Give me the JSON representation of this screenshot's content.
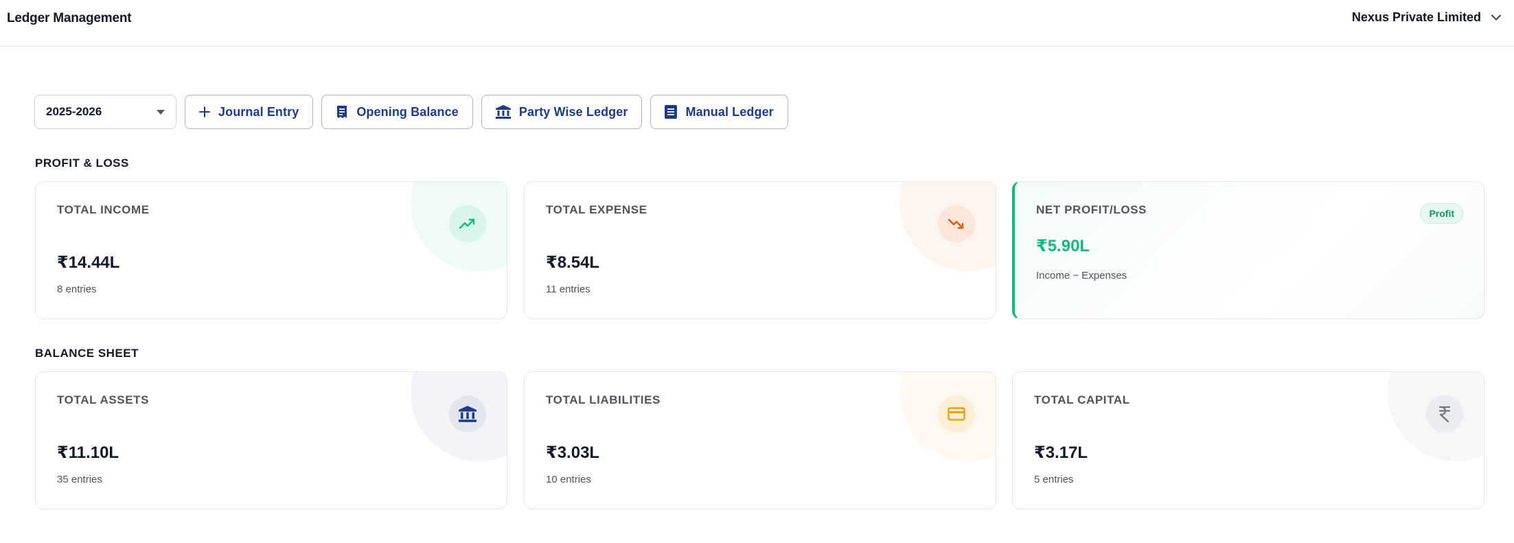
{
  "header": {
    "title": "Ledger Management",
    "company": "Nexus Private Limited"
  },
  "toolbar": {
    "year": "2025-2026",
    "buttons": [
      {
        "label": "Journal Entry",
        "icon": "plus-icon"
      },
      {
        "label": "Opening Balance",
        "icon": "receipt-icon"
      },
      {
        "label": "Party Wise Ledger",
        "icon": "bank-icon"
      },
      {
        "label": "Manual Ledger",
        "icon": "document-icon"
      }
    ]
  },
  "profit_loss": {
    "title": "PROFIT & LOSS",
    "cards": [
      {
        "label": "TOTAL INCOME",
        "value": "₹14.44L",
        "sub": "8 entries",
        "icon": "trending-up-icon",
        "color": "#10b981"
      },
      {
        "label": "TOTAL EXPENSE",
        "value": "₹8.54L",
        "sub": "11 entries",
        "icon": "trending-down-icon",
        "color": "#ea580c"
      },
      {
        "label": "NET PROFIT/LOSS",
        "value": "₹5.90L",
        "sub": "Income − Expenses",
        "badge": "Profit",
        "color": "#10b981"
      }
    ]
  },
  "balance_sheet": {
    "title": "BALANCE SHEET",
    "cards": [
      {
        "label": "TOTAL ASSETS",
        "value": "₹11.10L",
        "sub": "35 entries",
        "icon": "bank-icon",
        "color": "#1e3a8a"
      },
      {
        "label": "TOTAL LIABILITIES",
        "value": "₹3.03L",
        "sub": "10 entries",
        "icon": "credit-card-icon",
        "color": "#f59e0b"
      },
      {
        "label": "TOTAL CAPITAL",
        "value": "₹3.17L",
        "sub": "5 entries",
        "icon": "rupee-icon",
        "color": "#6b7280"
      }
    ]
  }
}
